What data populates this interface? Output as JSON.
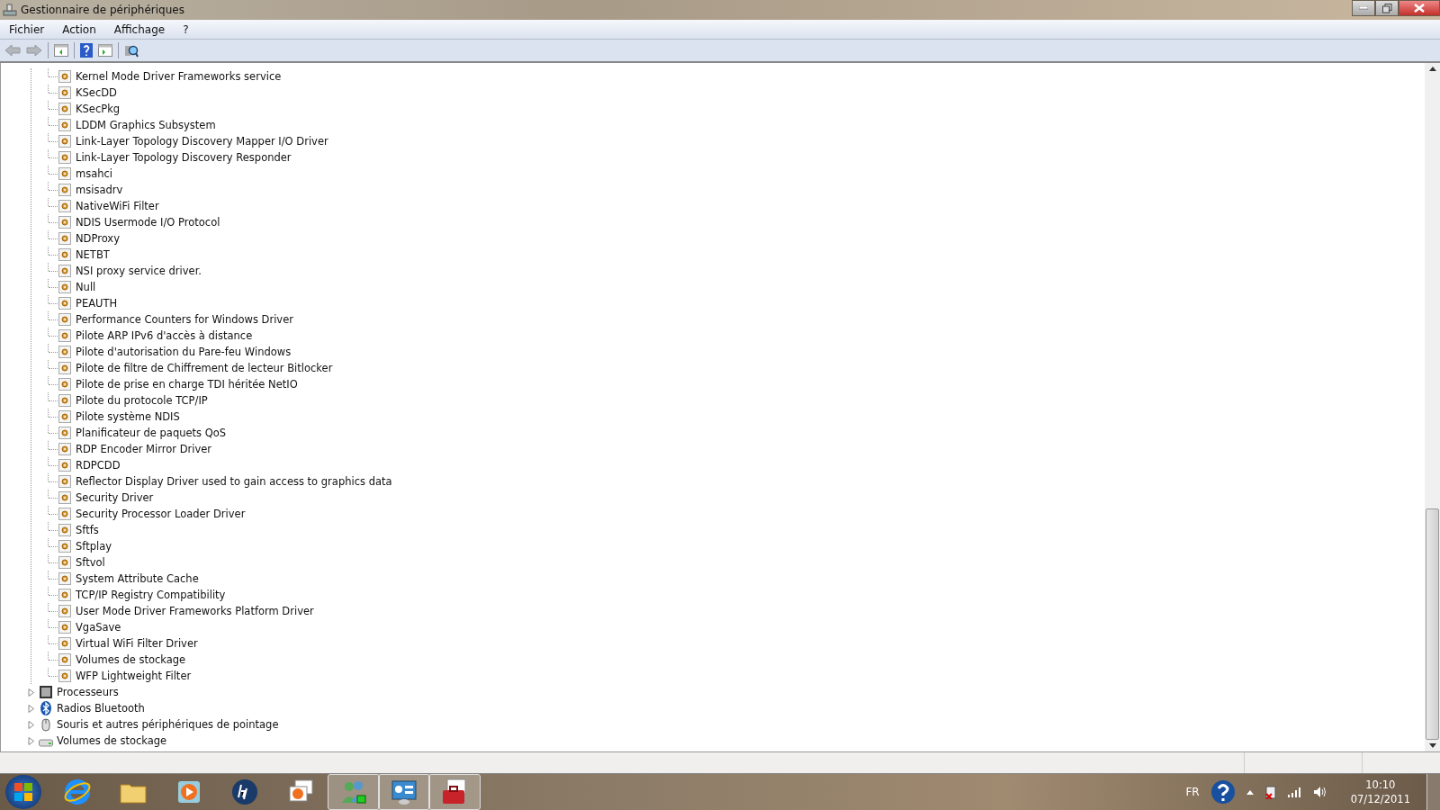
{
  "window": {
    "title": "Gestionnaire de périphériques"
  },
  "menu": [
    "Fichier",
    "Action",
    "Affichage",
    "?"
  ],
  "toolbar": [
    {
      "kind": "back",
      "disabled": true
    },
    {
      "kind": "forward",
      "disabled": true
    },
    {
      "kind": "sep"
    },
    {
      "kind": "console"
    },
    {
      "kind": "sep"
    },
    {
      "kind": "help"
    },
    {
      "kind": "pane"
    },
    {
      "kind": "sep"
    },
    {
      "kind": "scan"
    }
  ],
  "tree": {
    "continued_children": [
      "Kernel Mode Driver Frameworks service",
      "KSecDD",
      "KSecPkg",
      "LDDM Graphics Subsystem",
      "Link-Layer Topology Discovery Mapper I/O Driver",
      "Link-Layer Topology Discovery Responder",
      "msahci",
      "msisadrv",
      "NativeWiFi Filter",
      "NDIS Usermode I/O Protocol",
      "NDProxy",
      "NETBT",
      "NSI proxy service driver.",
      "Null",
      "PEAUTH",
      "Performance Counters for Windows Driver",
      "Pilote ARP IPv6 d'accès à distance",
      "Pilote d'autorisation du Pare-feu Windows",
      "Pilote de filtre de Chiffrement de lecteur Bitlocker",
      "Pilote de prise en charge TDI héritée NetIO",
      "Pilote du protocole TCP/IP",
      "Pilote système NDIS",
      "Planificateur de paquets QoS",
      "RDP Encoder Mirror Driver",
      "RDPCDD",
      "Reflector Display Driver used to gain access to graphics data",
      "Security Driver",
      "Security Processor Loader Driver",
      "Sftfs",
      "Sftplay",
      "Sftvol",
      "System Attribute Cache",
      "TCP/IP Registry Compatibility",
      "User Mode Driver Frameworks Platform Driver",
      "VgaSave",
      "Virtual WiFi Filter Driver",
      "Volumes de stockage",
      "WFP Lightweight Filter"
    ],
    "items": [
      {
        "label": "Processeurs",
        "kind": "chip",
        "expanded": false
      },
      {
        "label": "Radios Bluetooth",
        "kind": "bluetooth",
        "expanded": false
      },
      {
        "label": "Souris et autres périphériques de pointage",
        "kind": "mouse",
        "expanded": false
      },
      {
        "label": "Volumes de stockage",
        "kind": "drive",
        "expanded": false
      }
    ]
  },
  "taskbar": {
    "apps": [
      {
        "kind": "ie",
        "running": false
      },
      {
        "kind": "folder",
        "running": false
      },
      {
        "kind": "media",
        "running": false
      },
      {
        "kind": "hp",
        "running": false
      },
      {
        "kind": "photos",
        "running": false
      },
      {
        "kind": "users",
        "running": true
      },
      {
        "kind": "panel",
        "running": true
      },
      {
        "kind": "toolbox",
        "running": true
      }
    ],
    "language": "FR",
    "time": "10:10",
    "date": "07/12/2011"
  }
}
